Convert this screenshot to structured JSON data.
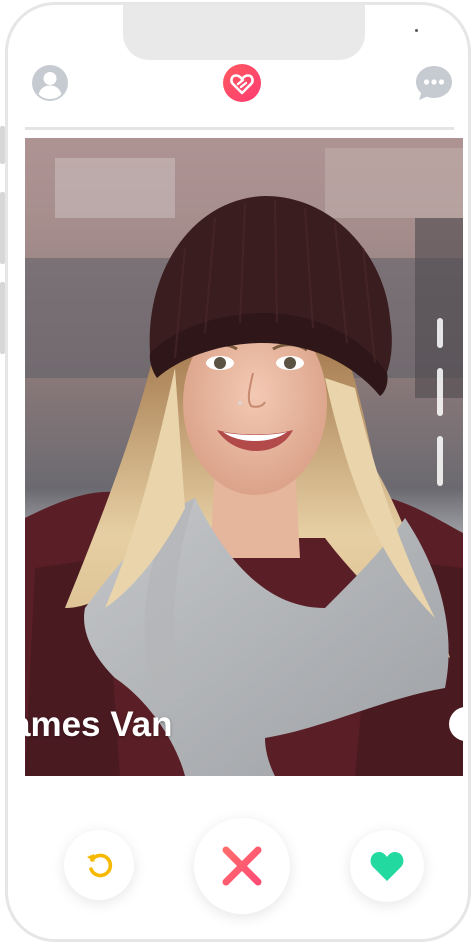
{
  "app": {
    "header": {
      "profile_icon": "user-icon",
      "logo_icon": "heart-logo-icon",
      "chat_icon": "chat-bubble-icon"
    },
    "card": {
      "name": "ames Van",
      "photo_description_icon": "profile-photo"
    },
    "actions": {
      "rewind_icon": "rewind-icon",
      "nope_icon": "close-icon",
      "like_icon": "heart-icon"
    },
    "colors": {
      "brand": "#fe3c72",
      "rewind": "#f5b900",
      "nope": "#fd5068",
      "like": "#22d9a0",
      "icon_gray": "#c6cbd1"
    }
  }
}
